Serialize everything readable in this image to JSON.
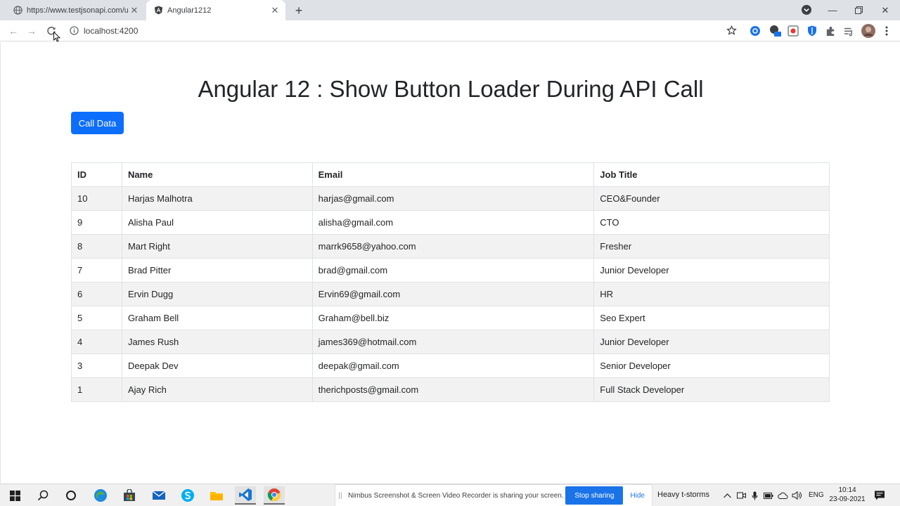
{
  "browser": {
    "tabs": [
      {
        "title": "https://www.testjsonapi.com/use",
        "icon": "globe-icon"
      },
      {
        "title": "Angular1212",
        "icon": "angular-icon"
      }
    ],
    "address": "localhost:4200"
  },
  "page": {
    "title": "Angular 12 : Show Button Loader During API Call",
    "button_label": "Call Data",
    "accent_color": "#0d6efd"
  },
  "table": {
    "headers": [
      "ID",
      "Name",
      "Email",
      "Job Title"
    ],
    "rows": [
      [
        "10",
        "Harjas Malhotra",
        "harjas@gmail.com",
        "CEO&Founder"
      ],
      [
        "9",
        "Alisha Paul",
        "alisha@gmail.com",
        "CTO"
      ],
      [
        "8",
        "Mart Right",
        "marrk9658@yahoo.com",
        "Fresher"
      ],
      [
        "7",
        "Brad Pitter",
        "brad@gmail.com",
        "Junior Developer"
      ],
      [
        "6",
        "Ervin Dugg",
        "Ervin69@gmail.com",
        "HR"
      ],
      [
        "5",
        "Graham Bell",
        "Graham@bell.biz",
        "Seo Expert"
      ],
      [
        "4",
        "James Rush",
        "james369@hotmail.com",
        "Junior Developer"
      ],
      [
        "3",
        "Deepak Dev",
        "deepak@gmail.com",
        "Senior Developer"
      ],
      [
        "1",
        "Ajay Rich",
        "therichposts@gmail.com",
        "Full Stack Developer"
      ]
    ]
  },
  "sharing_bar": {
    "message": "Nimbus Screenshot & Screen Video Recorder is sharing your screen.",
    "stop_label": "Stop sharing",
    "hide_label": "Hide"
  },
  "taskbar": {
    "weather": "Heavy t-storms",
    "language": "ENG",
    "time": "10:14",
    "date": "23-09-2021"
  }
}
